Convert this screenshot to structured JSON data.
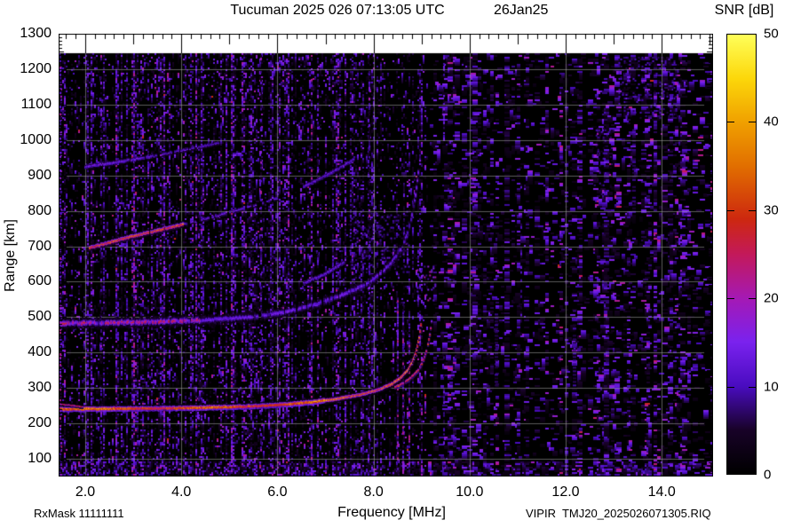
{
  "header": {
    "title": "Tucuman 2025 026 07:13:05 UTC",
    "date": "26Jan25"
  },
  "footer": {
    "rx_mask": "RxMask 11111111",
    "file": "VIPIR  TMJ20_2025026071305.RIQ"
  },
  "chart_data": {
    "type": "heatmap",
    "title": "Tucuman 2025 026 07:13:05 UTC 26Jan25",
    "xlabel": "Frequency [MHz]",
    "ylabel": "Range [km]",
    "xlim": [
      1.45,
      15.07
    ],
    "ylim": [
      50,
      1300
    ],
    "x_ticks": [
      2,
      4,
      6,
      8,
      10,
      12,
      14
    ],
    "x_tick_labels": [
      "2.0",
      "4.0",
      "6.0",
      "8.0",
      "10.0",
      "12.0",
      "14.0"
    ],
    "x_minor_tick_step_mhz": 0.2,
    "y_ticks": [
      100,
      200,
      300,
      400,
      500,
      600,
      700,
      800,
      900,
      1000,
      1100,
      1200,
      1300
    ],
    "y_tick_labels": [
      "100",
      "200",
      "300",
      "400",
      "500",
      "600",
      "700",
      "800",
      "900",
      "1000",
      "1100",
      "1200",
      "1300"
    ],
    "y_minor_tick_step_km": 10,
    "grid": true,
    "grid_x_step_mhz": 2,
    "grid_y_step_km": 100,
    "max_data_range_km": 1245,
    "colorbar": {
      "title": "SNR [dB]",
      "min": 0,
      "max": 50,
      "ticks": [
        0,
        10,
        20,
        30,
        40,
        50
      ],
      "tick_labels": [
        "0",
        "10",
        "20",
        "30",
        "40",
        "50"
      ],
      "palette": [
        [
          0.0,
          "#000000"
        ],
        [
          0.1,
          "#180228"
        ],
        [
          0.2,
          "#4a0cc0"
        ],
        [
          0.3,
          "#7a22ee"
        ],
        [
          0.4,
          "#a519b4"
        ],
        [
          0.5,
          "#c3195a"
        ],
        [
          0.58,
          "#cd280f"
        ],
        [
          0.7,
          "#e16e00"
        ],
        [
          0.8,
          "#f0a000"
        ],
        [
          0.9,
          "#fcd70a"
        ],
        [
          1.0,
          "#ffff5a"
        ]
      ]
    },
    "traces": {
      "hop1_o": {
        "points": [
          [
            1.45,
            240
          ],
          [
            2.5,
            241
          ],
          [
            3.5,
            242
          ],
          [
            4.5,
            244
          ],
          [
            5.5,
            248
          ],
          [
            6.2,
            253
          ],
          [
            6.8,
            261
          ],
          [
            7.3,
            270
          ],
          [
            7.8,
            283
          ],
          [
            8.1,
            295
          ],
          [
            8.35,
            309
          ],
          [
            8.55,
            327
          ],
          [
            8.7,
            348
          ],
          [
            8.8,
            372
          ],
          [
            8.88,
            403
          ],
          [
            8.94,
            440
          ],
          [
            8.98,
            478
          ],
          [
            9.01,
            515
          ],
          [
            9.03,
            552
          ]
        ],
        "snr_db": 34
      },
      "hop1_x": {
        "offset_mhz": 0.22,
        "f_start": 8.45,
        "snr_db": 30
      },
      "hop1_hook": {
        "points": [
          [
            1.45,
            254
          ],
          [
            1.75,
            250
          ],
          [
            1.98,
            245
          ]
        ],
        "snr_db": 24
      },
      "hop2": {
        "points": [
          [
            1.45,
            482
          ],
          [
            3.0,
            485
          ],
          [
            4.5,
            491
          ],
          [
            5.5,
            500
          ],
          [
            6.2,
            515
          ],
          [
            6.8,
            535
          ],
          [
            7.3,
            560
          ],
          [
            7.8,
            590
          ],
          [
            8.1,
            618
          ],
          [
            8.35,
            650
          ],
          [
            8.55,
            690
          ],
          [
            8.7,
            735
          ],
          [
            8.8,
            790
          ],
          [
            8.88,
            855
          ],
          [
            8.94,
            925
          ]
        ],
        "snr_db_core": 26,
        "snr_db_diffuse": 12,
        "core_f_max": 4.4
      },
      "streaks": [
        {
          "name": "hop3-oblique",
          "points": [
            [
              2.1,
              695
            ],
            [
              3.0,
              728
            ],
            [
              4.0,
              760
            ],
            [
              5.0,
              795
            ],
            [
              6.0,
              835
            ]
          ],
          "core_snr_db": 31,
          "core_f_max": 4.05,
          "tail_snr_db": 12
        },
        {
          "name": "hop4-oblique",
          "points": [
            [
              2.0,
              924
            ],
            [
              2.7,
              938
            ],
            [
              3.3,
              952
            ],
            [
              4.1,
              972
            ],
            [
              4.8,
              992
            ]
          ],
          "core_snr_db": 14,
          "core_f_max": 3.4,
          "tail_snr_db": 11
        },
        {
          "name": "mid-diffuse-echo",
          "points": [
            [
              6.55,
              596
            ],
            [
              7.0,
              622
            ],
            [
              7.4,
              655
            ]
          ],
          "core_snr_db": 13,
          "core_f_max": 7.4,
          "tail_snr_db": 12
        },
        {
          "name": "high-diffuse-echo",
          "points": [
            [
              6.55,
              868
            ],
            [
              7.1,
              905
            ],
            [
              7.6,
              945
            ]
          ],
          "core_snr_db": 12,
          "core_f_max": 7.6,
          "tail_snr_db": 11
        }
      ],
      "patches": [
        {
          "f0": 13.1,
          "f1": 14.35,
          "r0": 1060,
          "r1": 1235,
          "density": 0.2,
          "snr_db": 8
        },
        {
          "f0": 12.55,
          "f1": 12.95,
          "r0": 840,
          "r1": 1040,
          "density": 0.16,
          "snr_db": 7
        },
        {
          "f0": 8.9,
          "f1": 9.3,
          "r0": 545,
          "r1": 645,
          "density": 0.14,
          "snr_db": 15
        },
        {
          "f0": 7.5,
          "f1": 8.75,
          "r0": 620,
          "r1": 800,
          "density": 0.16,
          "snr_db": 9
        }
      ],
      "ladders": [
        {
          "f": 13.38,
          "r0": 790,
          "r1": 1030
        },
        {
          "f": 12.15,
          "r0": 300,
          "r1": 520
        },
        {
          "f": 10.52,
          "r0": 290,
          "r1": 510
        }
      ],
      "rfi_columns": [
        {
          "f": 1.47,
          "r0": 60,
          "r1": 1240,
          "s": 1.8
        },
        {
          "f": 2.32,
          "r0": 60,
          "r1": 1240,
          "s": 1.3
        },
        {
          "f": 3.3,
          "r0": 60,
          "r1": 1240,
          "s": 1.3
        },
        {
          "f": 4.35,
          "r0": 150,
          "r1": 1240,
          "s": 1.2
        },
        {
          "f": 5.65,
          "r0": 60,
          "r1": 1240,
          "s": 1.3
        },
        {
          "f": 6.7,
          "r0": 60,
          "r1": 1240,
          "s": 1.9
        },
        {
          "f": 6.82,
          "r0": 60,
          "r1": 1240,
          "s": 1.5
        },
        {
          "f": 7.9,
          "r0": 100,
          "r1": 1240,
          "s": 1.4
        },
        {
          "f": 8.48,
          "r0": 60,
          "r1": 555,
          "s": 2.2
        },
        {
          "f": 8.6,
          "r0": 60,
          "r1": 545,
          "s": 2.0
        },
        {
          "f": 8.72,
          "r0": 60,
          "r1": 520,
          "s": 1.7
        },
        {
          "f": 9.45,
          "r0": 60,
          "r1": 420,
          "s": 1.1
        },
        {
          "f": 9.45,
          "r0": 990,
          "r1": 1240,
          "s": 1.2
        },
        {
          "f": 10.35,
          "r0": 60,
          "r1": 320,
          "s": 0.9
        },
        {
          "f": 11.05,
          "r0": 400,
          "r1": 900,
          "s": 0.8
        }
      ]
    },
    "noise": {
      "left_density": 0.33,
      "mid_density": 0.2,
      "right_density": 0.1,
      "left_mid_boundary_mhz": 6.35,
      "mid_right_boundary_mhz": 9.1,
      "bottom_band_max_km": 95,
      "bottom_band_boost": 2.4
    }
  }
}
